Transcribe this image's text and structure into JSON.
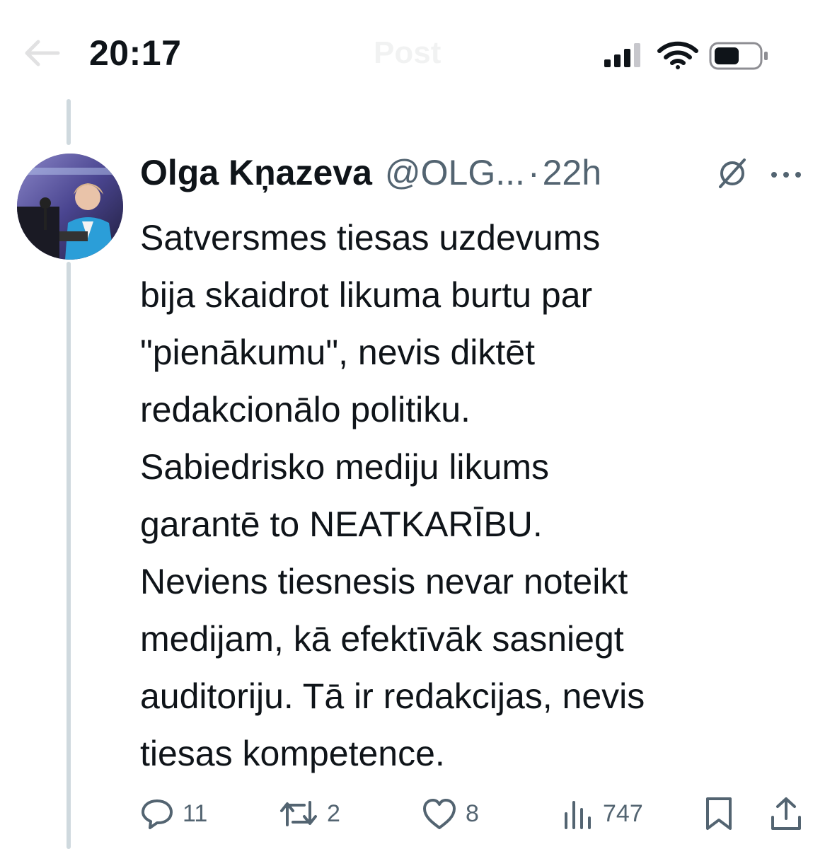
{
  "status_bar": {
    "time": "20:17",
    "ghost_title": "Post",
    "icons": [
      "back-arrow-icon",
      "cellular-signal-icon",
      "wifi-icon",
      "battery-icon"
    ]
  },
  "tweet": {
    "author_name": "Olga Kņazeva",
    "author_handle": "@OLG...",
    "separator": "·",
    "age": "22h",
    "text_lines": [
      "Satversmes tiesas uzdevums",
      "bija skaidrot likuma burtu par",
      "\"pienākumu\", nevis diktēt",
      "redakcionālo politiku.",
      "Sabiedrisko mediju likums",
      "garantē to NEATKARĪBU.",
      "Neviens tiesnesis nevar noteikt",
      "medijam, kā efektīvāk sasniegt",
      "auditoriju. Tā ir redakcijas, nevis",
      "tiesas kompetence."
    ],
    "actions": {
      "replies": "11",
      "reposts": "2",
      "likes": "8",
      "views": "747"
    }
  },
  "colors": {
    "text": "#0f1419",
    "secondary": "#536471",
    "thread_line": "#cfd9de"
  }
}
